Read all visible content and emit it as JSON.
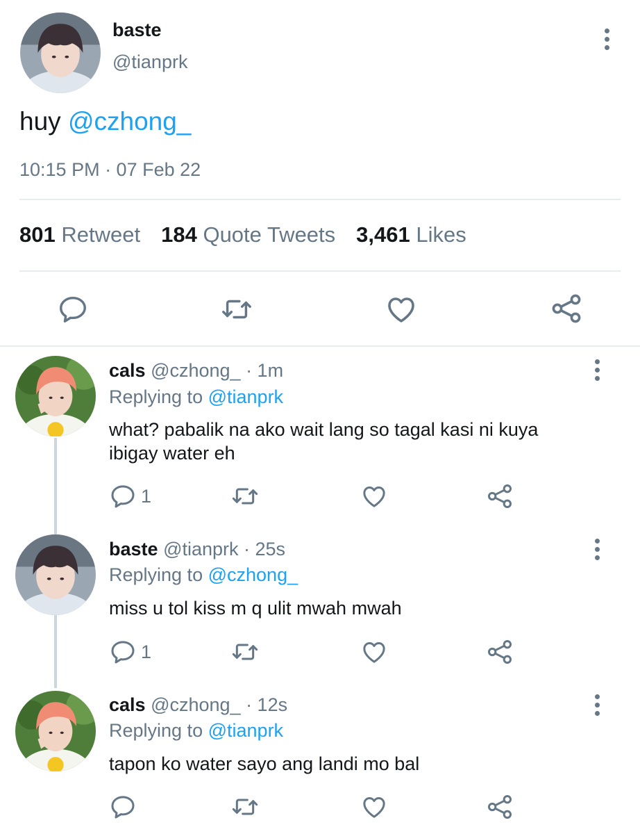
{
  "main_tweet": {
    "display_name": "baste",
    "handle": "@tianprk",
    "text_prefix": "huy",
    "mention": "@czhong_",
    "timestamp": "10:15 PM · 07 Feb 22",
    "stats": {
      "retweets_count": "801",
      "retweets_label": "Retweet",
      "quotes_count": "184",
      "quotes_label": "Quote Tweets",
      "likes_count": "3,461",
      "likes_label": "Likes"
    },
    "actions": [
      "reply-icon",
      "retweet-icon",
      "like-icon",
      "share-icon"
    ]
  },
  "replies": [
    {
      "display_name": "cals",
      "meta": "@czhong_ · 1m",
      "replying_label": "Replying to",
      "replying_to": "@tianprk",
      "text_line1": "what? pabalik na ako wait lang so tagal kasi ni kuya",
      "text_line2": "ibigay water eh",
      "reply_count": "1"
    },
    {
      "display_name": "baste",
      "meta": "@tianprk · 25s",
      "replying_label": "Replying to",
      "replying_to": "@czhong_",
      "text_line1": "miss u tol kiss m q ulit mwah mwah",
      "reply_count": "1"
    },
    {
      "display_name": "cals",
      "meta": "@czhong_ · 12s",
      "replying_label": "Replying to",
      "replying_to": "@tianprk",
      "text_line1": "tapon ko water sayo ang landi mo bal",
      "reply_count": ""
    }
  ],
  "colors": {
    "accent": "#1da1f2",
    "muted": "#657786",
    "text": "#14171a",
    "divider": "#e6ecf0"
  }
}
